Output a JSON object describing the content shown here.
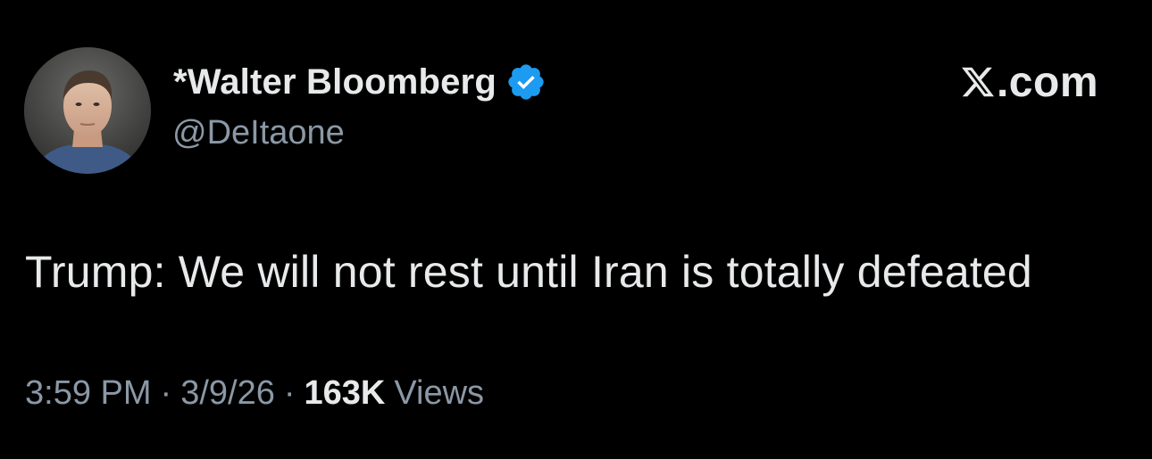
{
  "tweet": {
    "author": {
      "display_name": "*Walter Bloomberg",
      "handle": "@DeItaone",
      "verified": true,
      "verified_icon": "verified-badge-icon",
      "avatar": "author-avatar-photo"
    },
    "brand": {
      "logo_icon": "x-logo-icon",
      "text": ".com"
    },
    "text": "Trump: We will not rest until Iran is totally defeated",
    "meta": {
      "time": "3:59 PM",
      "separator": "·",
      "date": "3/9/26",
      "views_count": "163K",
      "views_label": "Views"
    }
  },
  "colors": {
    "background": "#000000",
    "primary_text": "#e7e9ea",
    "secondary_text": "#8b98a5",
    "verified_blue": "#1d9bf0"
  }
}
